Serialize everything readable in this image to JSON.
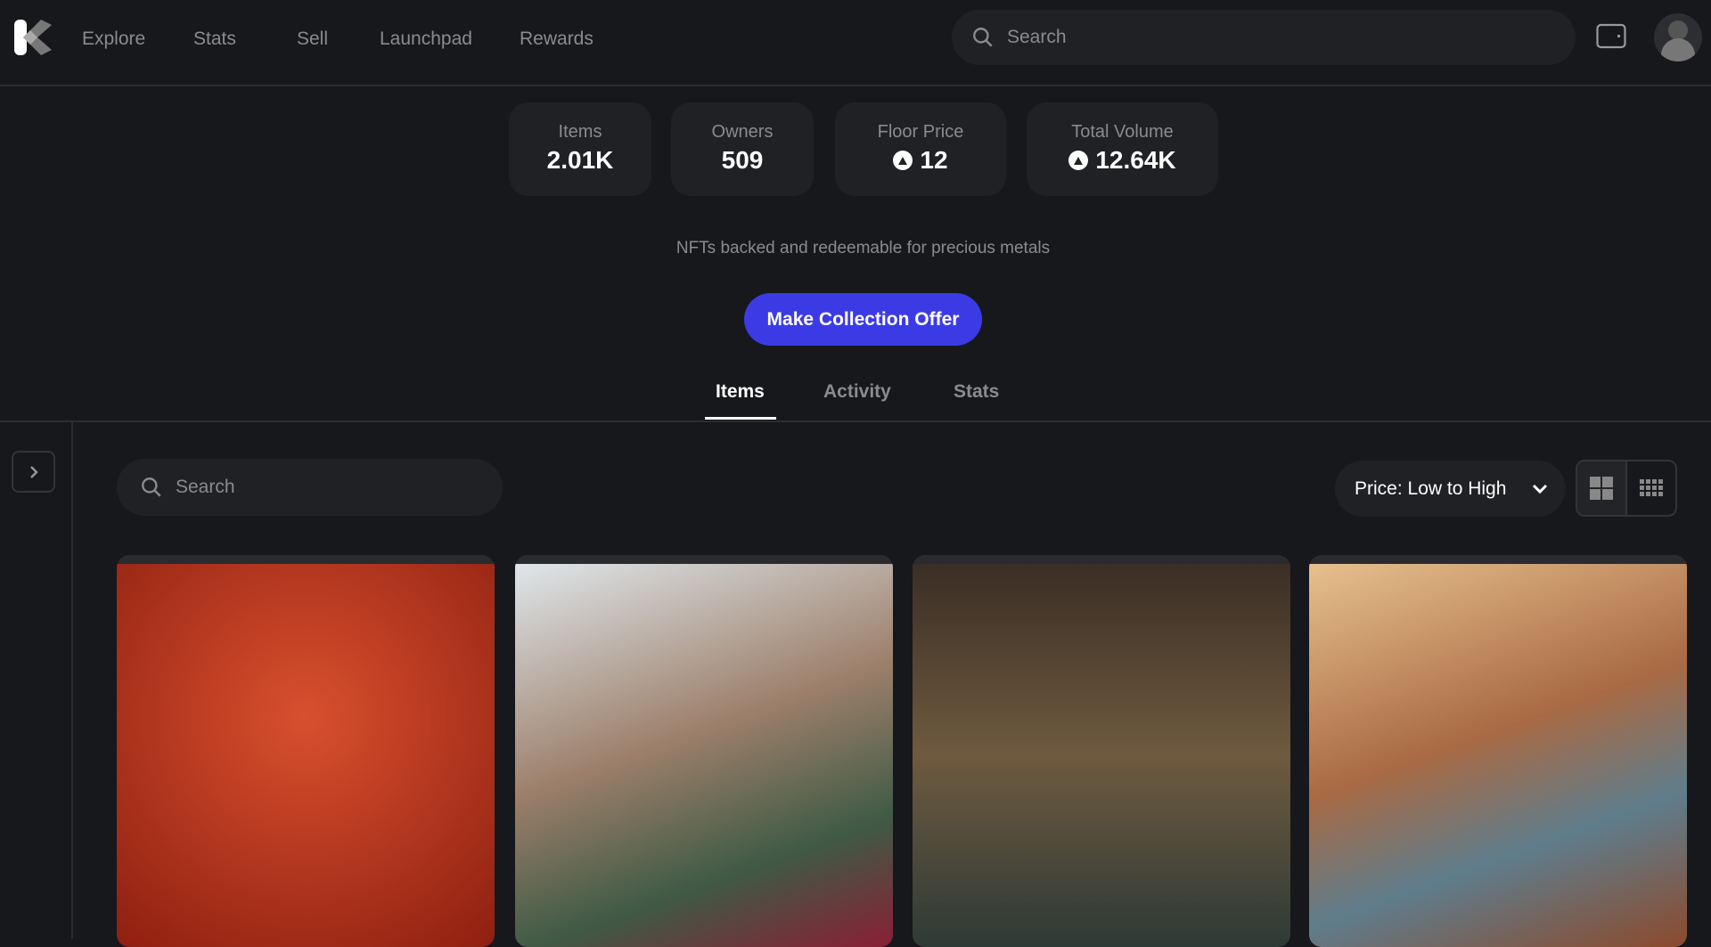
{
  "nav": {
    "items": [
      "Explore",
      "Stats",
      "Sell",
      "Launchpad",
      "Rewards"
    ],
    "search_placeholder": "Search"
  },
  "stats": [
    {
      "label": "Items",
      "value": "2.01K"
    },
    {
      "label": "Owners",
      "value": "509"
    },
    {
      "label": "Floor Price",
      "value": "12",
      "currency_icon": "avax-icon"
    },
    {
      "label": "Total Volume",
      "value": "12.64K",
      "currency_icon": "avax-icon"
    }
  ],
  "description": "NFTs backed and redeemable for precious metals",
  "offer_button": "Make Collection Offer",
  "tabs": [
    {
      "label": "Items",
      "active": true
    },
    {
      "label": "Activity"
    },
    {
      "label": "Stats"
    }
  ],
  "filter": {
    "search_placeholder": "Search",
    "sort": "Price: Low to High",
    "view": "large-grid"
  },
  "colors": {
    "accent": "#3b3be6",
    "bg": "#17181b",
    "panel": "#202124"
  },
  "nfts": [
    {
      "bg": "#b8321c"
    },
    {
      "bg": "#8fa3b0"
    },
    {
      "bg": "#4a3a2c"
    },
    {
      "bg": "#b88a5a"
    }
  ]
}
